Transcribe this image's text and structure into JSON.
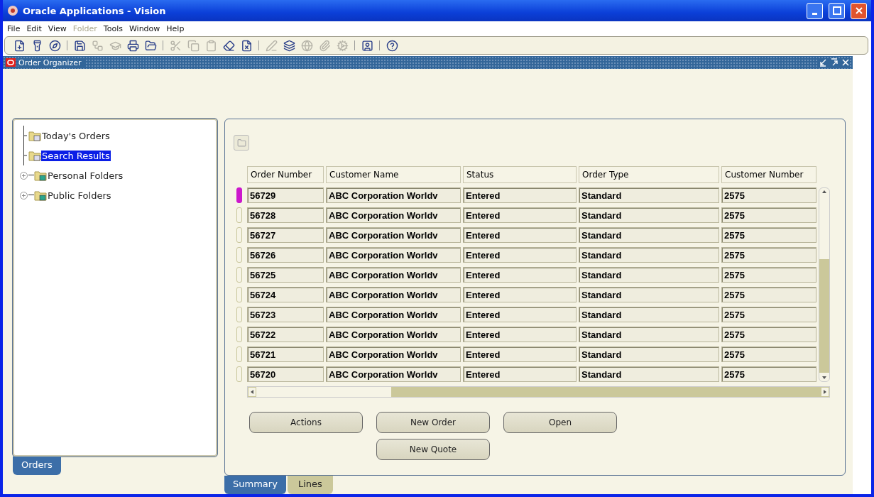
{
  "window": {
    "title": "Oracle Applications - Vision"
  },
  "menu": [
    {
      "label": "File",
      "disabled": false
    },
    {
      "label": "Edit",
      "disabled": false
    },
    {
      "label": "View",
      "disabled": false
    },
    {
      "label": "Folder",
      "disabled": true
    },
    {
      "label": "Tools",
      "disabled": false
    },
    {
      "label": "Window",
      "disabled": false
    },
    {
      "label": "Help",
      "disabled": false
    }
  ],
  "toolbar": [
    {
      "kind": "button",
      "disabled": false
    },
    {
      "kind": "button",
      "disabled": false
    },
    {
      "kind": "button",
      "disabled": false
    },
    {
      "kind": "separator"
    },
    {
      "kind": "button",
      "disabled": false
    },
    {
      "kind": "button",
      "disabled": true
    },
    {
      "kind": "button",
      "disabled": true
    },
    {
      "kind": "button",
      "disabled": false
    },
    {
      "kind": "button",
      "disabled": false
    },
    {
      "kind": "separator"
    },
    {
      "kind": "button",
      "disabled": true
    },
    {
      "kind": "button",
      "disabled": true
    },
    {
      "kind": "button",
      "disabled": true
    },
    {
      "kind": "button",
      "disabled": false
    },
    {
      "kind": "button",
      "disabled": false
    },
    {
      "kind": "separator"
    },
    {
      "kind": "button",
      "disabled": true
    },
    {
      "kind": "button",
      "disabled": false
    },
    {
      "kind": "button",
      "disabled": true
    },
    {
      "kind": "button",
      "disabled": true
    },
    {
      "kind": "button",
      "disabled": true
    },
    {
      "kind": "separator"
    },
    {
      "kind": "button",
      "disabled": false
    },
    {
      "kind": "separator"
    },
    {
      "kind": "button",
      "disabled": false
    }
  ],
  "form": {
    "title": "Order Organizer"
  },
  "tree": {
    "items": [
      {
        "label": "Today's Orders",
        "kind": "leaf",
        "selected": false
      },
      {
        "label": "Search Results",
        "kind": "leaf",
        "selected": true
      },
      {
        "label": "Personal Folders",
        "kind": "folder",
        "expanded": false,
        "selected": false
      },
      {
        "label": "Public Folders",
        "kind": "folder",
        "expanded": false,
        "selected": false
      }
    ]
  },
  "left_tabs": [
    {
      "label": "Orders",
      "selected": true
    }
  ],
  "table": {
    "columns": [
      "Order Number",
      "Customer Name",
      "Status",
      "Order Type",
      "Customer Number"
    ],
    "rows": [
      {
        "selected": true,
        "cells": [
          "56729",
          "ABC Corporation Worldv",
          "Entered",
          "Standard",
          "2575"
        ]
      },
      {
        "selected": false,
        "cells": [
          "56728",
          "ABC Corporation Worldv",
          "Entered",
          "Standard",
          "2575"
        ]
      },
      {
        "selected": false,
        "cells": [
          "56727",
          "ABC Corporation Worldv",
          "Entered",
          "Standard",
          "2575"
        ]
      },
      {
        "selected": false,
        "cells": [
          "56726",
          "ABC Corporation Worldv",
          "Entered",
          "Standard",
          "2575"
        ]
      },
      {
        "selected": false,
        "cells": [
          "56725",
          "ABC Corporation Worldv",
          "Entered",
          "Standard",
          "2575"
        ]
      },
      {
        "selected": false,
        "cells": [
          "56724",
          "ABC Corporation Worldv",
          "Entered",
          "Standard",
          "2575"
        ]
      },
      {
        "selected": false,
        "cells": [
          "56723",
          "ABC Corporation Worldv",
          "Entered",
          "Standard",
          "2575"
        ]
      },
      {
        "selected": false,
        "cells": [
          "56722",
          "ABC Corporation Worldv",
          "Entered",
          "Standard",
          "2575"
        ]
      },
      {
        "selected": false,
        "cells": [
          "56721",
          "ABC Corporation Worldv",
          "Entered",
          "Standard",
          "2575"
        ]
      },
      {
        "selected": false,
        "cells": [
          "56720",
          "ABC Corporation Worldv",
          "Entered",
          "Standard",
          "2575"
        ]
      }
    ]
  },
  "button_rows": [
    [
      "Actions",
      "New Order",
      "Open"
    ],
    [
      "New Quote"
    ]
  ],
  "bottom_tabs": [
    {
      "label": "Summary",
      "selected": true
    },
    {
      "label": "Lines",
      "selected": false
    }
  ]
}
